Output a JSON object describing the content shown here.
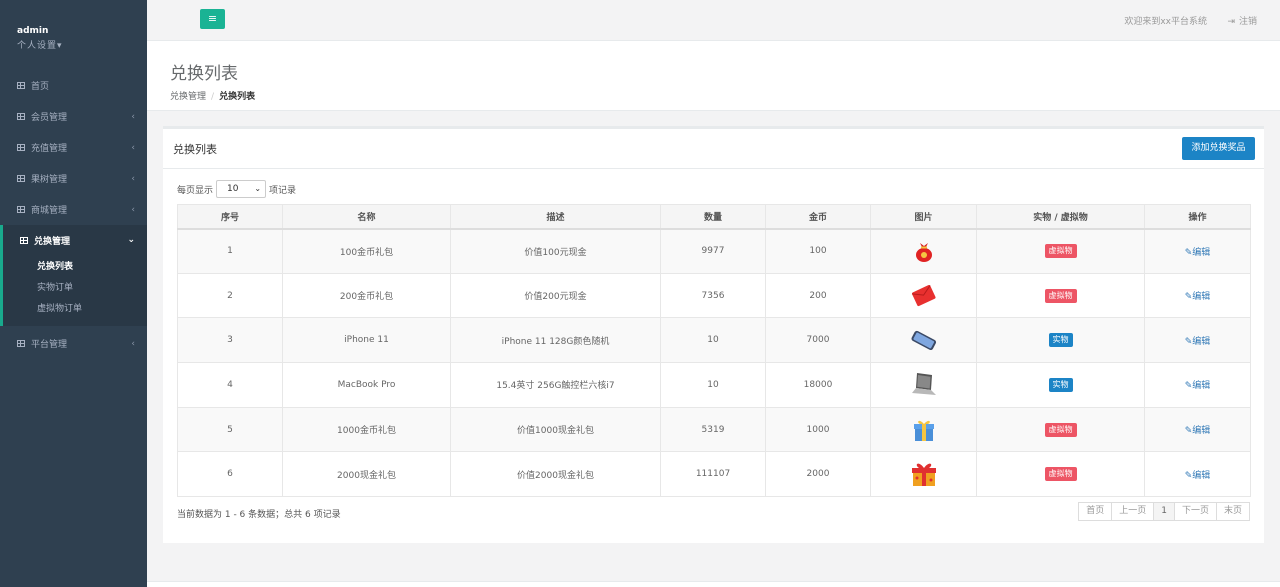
{
  "profile": {
    "name": "admin",
    "settings": "个人设置"
  },
  "nav": [
    {
      "label": "首页",
      "chev": ""
    },
    {
      "label": "会员管理",
      "chev": "‹"
    },
    {
      "label": "充值管理",
      "chev": "‹"
    },
    {
      "label": "果树管理",
      "chev": "‹"
    },
    {
      "label": "商城管理",
      "chev": "‹"
    },
    {
      "label": "兑换管理",
      "chev": "⌄"
    },
    {
      "label": "平台管理",
      "chev": "‹"
    }
  ],
  "subnav": [
    "兑换列表",
    "实物订单",
    "虚拟物订单"
  ],
  "topbar": {
    "menu_icon": "≡",
    "welcome": "欢迎来到xx平台系统",
    "logout": "注销",
    "logout_icon": "⇥"
  },
  "heading": {
    "title": "兑换列表",
    "crumb_parent": "兑换管理",
    "crumb_sep": "/",
    "crumb_current": "兑换列表"
  },
  "panel": {
    "title": "兑换列表",
    "add_button": "添加兑换奖品"
  },
  "length": {
    "prefix": "每页显示",
    "value": "10",
    "suffix": "项记录"
  },
  "table": {
    "headers": [
      "序号",
      "名称",
      "描述",
      "数量",
      "金币",
      "图片",
      "实物 / 虚拟物",
      "操作"
    ],
    "rows": [
      {
        "id": "1",
        "name": "100金币礼包",
        "desc": "价值100元现金",
        "qty": "9977",
        "coins": "100",
        "image": "money-bag-icon",
        "type": "虚拟物",
        "kind": "virtual",
        "action": "✎编辑"
      },
      {
        "id": "2",
        "name": "200金币礼包",
        "desc": "价值200元现金",
        "qty": "7356",
        "coins": "200",
        "image": "red-envelope-icon",
        "type": "虚拟物",
        "kind": "virtual",
        "action": "✎编辑"
      },
      {
        "id": "3",
        "name": "iPhone 11",
        "desc": "iPhone 11 128G颜色随机",
        "qty": "10",
        "coins": "7000",
        "image": "phone-icon",
        "type": "实物",
        "kind": "real",
        "action": "✎编辑"
      },
      {
        "id": "4",
        "name": "MacBook Pro",
        "desc": "15.4英寸 256G触控栏六核i7",
        "qty": "10",
        "coins": "18000",
        "image": "laptop-icon",
        "type": "实物",
        "kind": "real",
        "action": "✎编辑"
      },
      {
        "id": "5",
        "name": "1000金币礼包",
        "desc": "价值1000现金礼包",
        "qty": "5319",
        "coins": "1000",
        "image": "gift-box-icon",
        "type": "虚拟物",
        "kind": "virtual",
        "action": "✎编辑"
      },
      {
        "id": "6",
        "name": "2000现金礼包",
        "desc": "价值2000现金礼包",
        "qty": "111107",
        "coins": "2000",
        "image": "big-gift-icon",
        "type": "虚拟物",
        "kind": "virtual",
        "action": "✎编辑"
      }
    ]
  },
  "footer": {
    "info": "当前数据为 1 - 6 条数据；总共 6 项记录",
    "pager": [
      "首页",
      "上一页",
      "1",
      "下一页",
      "末页"
    ]
  },
  "colors": {
    "sidebar": "#2f4050",
    "accent": "#1ab394",
    "primary": "#1c84c6",
    "danger": "#ed5565"
  }
}
